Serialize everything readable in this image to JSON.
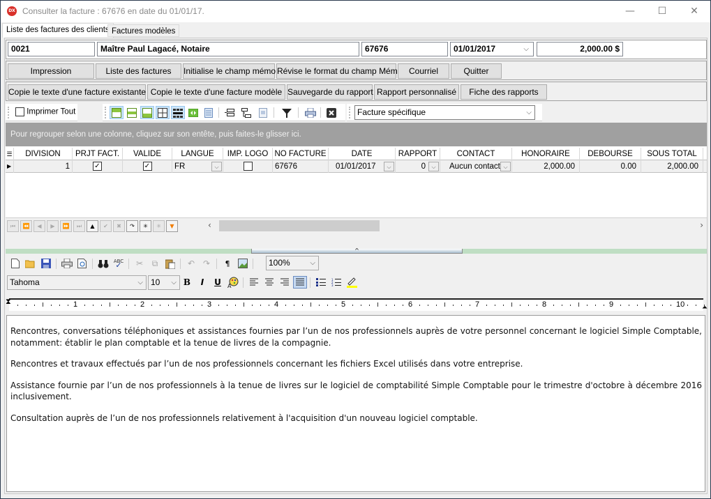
{
  "window": {
    "app_icon": "DX",
    "title": "Consulter la facture : 67676 en date du 01/01/17.",
    "controls": {
      "minimize": "—",
      "maximize": "☐",
      "close": "✕"
    }
  },
  "tabs": [
    {
      "label": "Liste des factures des clients",
      "active": true
    },
    {
      "label": "Factures modèles",
      "active": false
    }
  ],
  "header_fields": {
    "client_code": "0021",
    "client_name": "Maître Paul Lagacé, Notaire",
    "invoice_number": "67676",
    "invoice_date": "01/01/2017",
    "total": "2,000.00 $"
  },
  "buttons_row1": [
    "Impression",
    "Liste des factures",
    "Initialise le champ mémo",
    "Révise le format du champ Mémo",
    "Courriel",
    "Quitter"
  ],
  "buttons_row2": [
    "Copie le texte d'une facture existante",
    "Copie le texte d'une facture modèle",
    "Sauvegarde du rapport",
    "Rapport personnalisé",
    "Fiche des rapports"
  ],
  "grid_toolbar": {
    "print_all_label": "Imprimer Tout",
    "print_all_checked": false,
    "icons": [
      "layout-header-icon",
      "layout-middle-icon",
      "layout-footer-icon",
      "grid-lines-icon",
      "grid-dense-icon",
      "column-fit-icon",
      "rows-icon",
      "group-icon",
      "tree-icon",
      "preview-icon",
      "filter-icon",
      "print-icon",
      "clear-icon"
    ],
    "report_select": "Facture spécifique"
  },
  "group_hint": "Pour regrouper selon une colonne, cliquez sur son entête, puis faites-le glisser ici.",
  "grid": {
    "columns": [
      "DIVISION",
      "PRJT FACT.",
      "VALIDE",
      "LANGUE",
      "IMP. LOGO",
      "NO FACTURE",
      "DATE",
      "RAPPORT",
      "CONTACT",
      "HONORAIRE",
      "DEBOURSE",
      "SOUS TOTAL"
    ],
    "rows": [
      {
        "division": "1",
        "prjt_fact": true,
        "valide": true,
        "langue": "FR",
        "imp_logo": false,
        "no_facture": "67676",
        "date": "01/01/2017",
        "rapport": "0",
        "contact": "Aucun contact",
        "honoraire": "2,000.00",
        "debourse": "0.00",
        "sous_total": "2,000.00"
      }
    ]
  },
  "editor_toolbar": {
    "zoom": "100%",
    "font": "Tahoma",
    "size": "10",
    "highlight_color": "#ffff00"
  },
  "ruler": [
    "1",
    "2",
    "3",
    "4",
    "5",
    "6",
    "7",
    "8",
    "9",
    "10"
  ],
  "memo": [
    "Rencontres, conversations téléphoniques et assistances fournies par l’un de nos professionnels auprès de votre personnel concernant le logiciel Simple Comptable, notamment: établir le plan comptable et la tenue de livres de la compagnie.",
    "Rencontres et travaux effectués par l’un de nos professionnels concernant les fichiers Excel utilisés dans votre entreprise.",
    "Assistance fournie par l’un de nos professionnels à la tenue de livres sur le logiciel de comptabilité Simple Comptable pour le trimestre d'octobre à décembre 2016 inclusivement.",
    "Consultation auprès de l’un de nos professionnels relativement à l'acquisition d'un nouveau logiciel comptable."
  ],
  "colors": {
    "splitter": "#bfdec3",
    "group_area": "#a0a0a0",
    "filter_accent": "#f07c00"
  }
}
